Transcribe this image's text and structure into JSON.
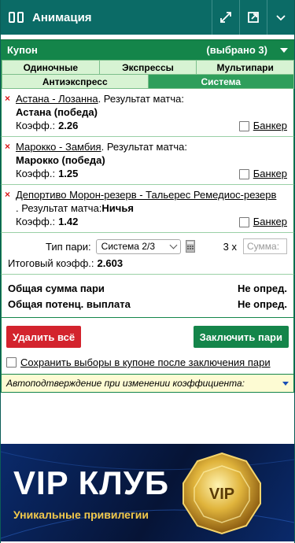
{
  "header": {
    "title": "Анимация",
    "buttons": [
      "expand-icon",
      "popout-icon",
      "chevron-down-icon"
    ]
  },
  "coupon": {
    "title": "Купон",
    "selected": "(выбрано 3)"
  },
  "tabs": {
    "row1": [
      "Одиночные",
      "Экспрессы",
      "Мультипари"
    ],
    "row2": [
      "Антиэкспресс",
      "Система"
    ],
    "active": "Система"
  },
  "bets": [
    {
      "match_link": "Астана - Лозанна",
      "suffix": ". Результат матча:",
      "pick": "Астана (победа)",
      "odds_label": "Коэфф.:",
      "odds": "2.26",
      "banker_label": "Банкер"
    },
    {
      "match_link": "Марокко - Замбия",
      "suffix": ". Результат матча:",
      "pick": "Марокко (победа)",
      "odds_label": "Коэфф.:",
      "odds": "1.25",
      "banker_label": "Банкер"
    },
    {
      "match_link": "Депортиво Морон-резерв - Тальерес Ремедиос-резерв",
      "suffix": ". Результат матча:",
      "pick": "Ничья",
      "odds_label": "Коэфф.:",
      "odds": "1.42",
      "banker_label": "Банкер"
    }
  ],
  "system": {
    "type_label": "Тип пари:",
    "type_value": "Система 2/3",
    "multiplier": "3 x",
    "sum_placeholder": "Сумма:",
    "total_label": "Итоговый коэфф.:",
    "total_value": "2.603"
  },
  "summary": {
    "stake_label": "Общая сумма пари",
    "stake_value": "Не опред.",
    "payout_label": "Общая потенц. выплата",
    "payout_value": "Не опред."
  },
  "actions": {
    "delete_all": "Удалить всё",
    "place_bet": "Заключить пари"
  },
  "keep_selections": "Сохранить выборы в купоне после заключения пари",
  "auto_confirm": "Автоподтверждение при изменении коэффициента:",
  "banner": {
    "title": "VIP КЛУБ",
    "subtitle": "Уникальные привилегии",
    "badge": "VIP"
  },
  "colors": {
    "header": "#0b6b66",
    "green": "#14854a",
    "delete": "#d3232d",
    "banner_bg": "#081a45",
    "gold": "#f2c94c"
  }
}
